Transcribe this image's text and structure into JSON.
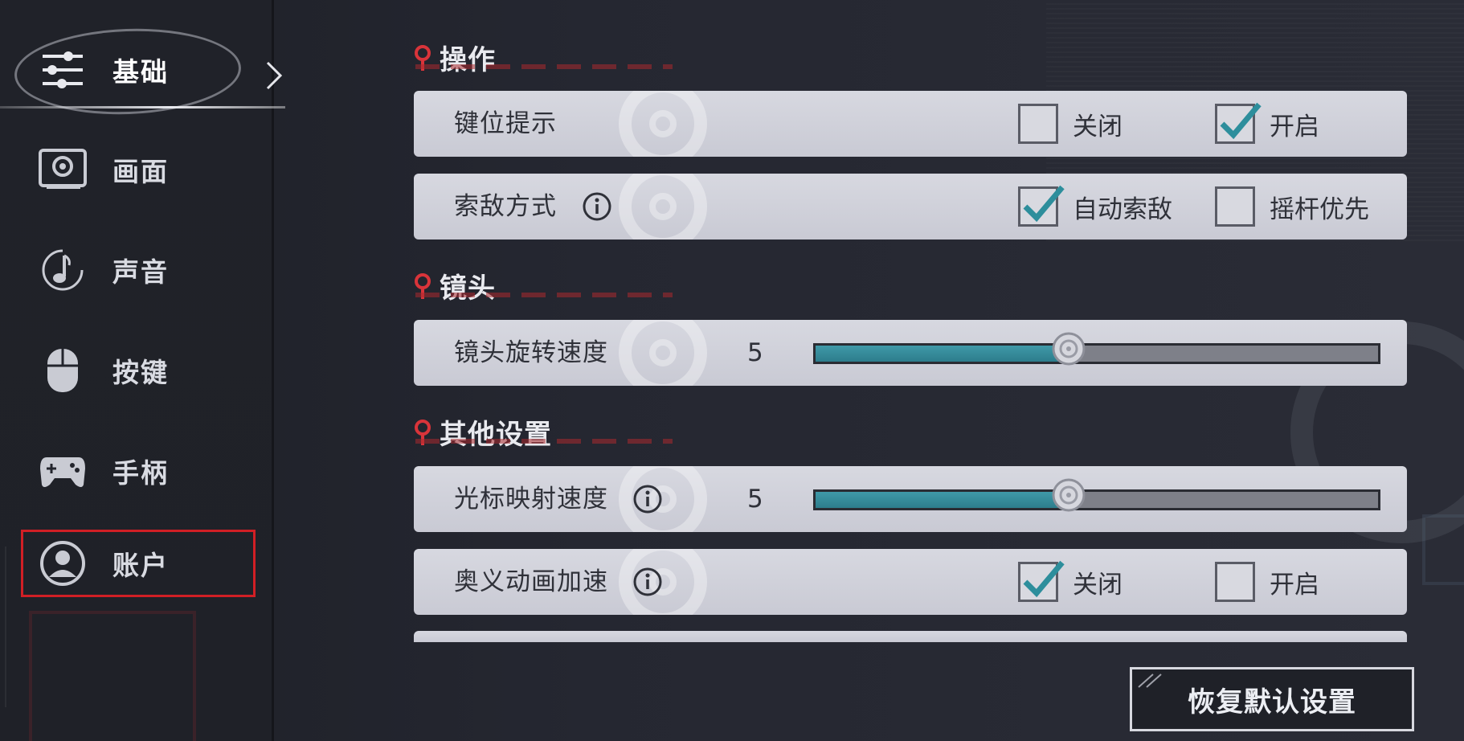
{
  "sidebar": {
    "items": [
      {
        "label": "基础",
        "icon": "sliders-icon",
        "active": true
      },
      {
        "label": "画面",
        "icon": "display-icon"
      },
      {
        "label": "声音",
        "icon": "music-note-icon"
      },
      {
        "label": "按键",
        "icon": "mouse-icon"
      },
      {
        "label": "手柄",
        "icon": "gamepad-icon"
      },
      {
        "label": "账户",
        "icon": "user-icon",
        "highlighted": true
      }
    ]
  },
  "sections": {
    "operation": {
      "title": "操作",
      "key_hint": {
        "label": "键位提示",
        "options": [
          "关闭",
          "开启"
        ],
        "selected": "开启"
      },
      "target_mode": {
        "label": "索敌方式",
        "options": [
          "自动索敌",
          "摇杆优先"
        ],
        "selected": "自动索敌"
      }
    },
    "camera": {
      "title": "镜头",
      "rotation_speed": {
        "label": "镜头旋转速度",
        "value": "5",
        "fill_fraction": 0.45
      }
    },
    "other": {
      "title": "其他设置",
      "cursor_speed": {
        "label": "光标映射速度",
        "value": "5",
        "fill_fraction": 0.45
      },
      "ultimate_anim_speedup": {
        "label": "奥义动画加速",
        "options": [
          "关闭",
          "开启"
        ],
        "selected": "关闭"
      }
    }
  },
  "footer": {
    "reset_label": "恢复默认设置"
  },
  "colors": {
    "accent_teal": "#2d8e9c",
    "section_pin_red": "#d9343a",
    "highlight_frame_red": "#d11f25",
    "row_bg": "#d0d1d9"
  }
}
